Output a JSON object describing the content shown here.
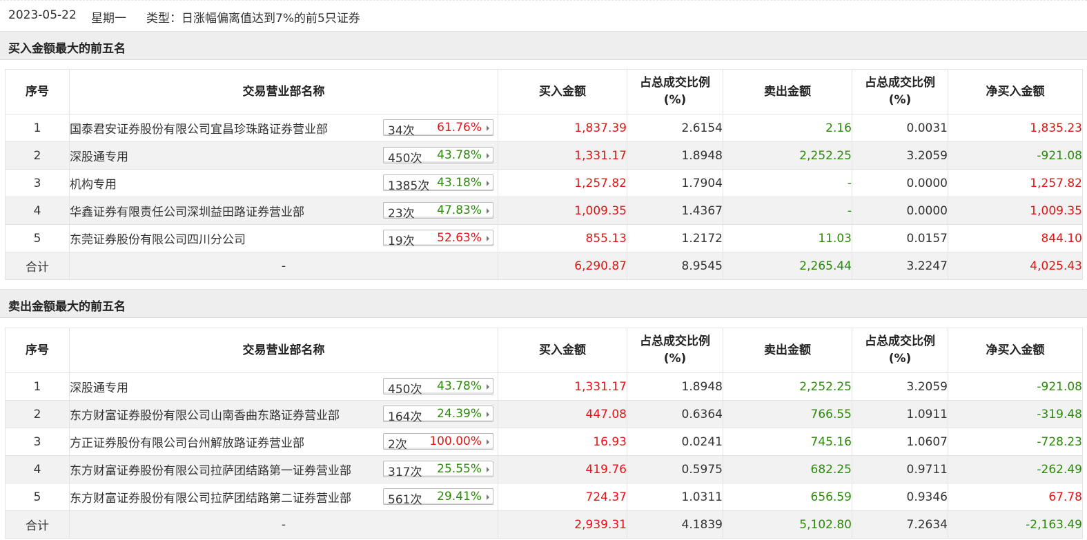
{
  "header": {
    "date": "2023-05-22",
    "weekday": "星期一",
    "type_text": "类型：日涨幅偏离值达到7%的前5只证券"
  },
  "columns": {
    "idx": "序号",
    "name": "交易营业部名称",
    "buy": "买入金额",
    "buy_ratio_line1": "占总成交比例",
    "buy_ratio_line2": "(%)",
    "sell": "卖出金额",
    "sell_ratio_line1": "占总成交比例",
    "sell_ratio_line2": "(%)",
    "net": "净买入金额"
  },
  "buy_section": {
    "title": "买入金额最大的前五名",
    "rows": [
      {
        "idx": "1",
        "name": "国泰君安证券股份有限公司宜昌珍珠路证券营业部",
        "count": "34次",
        "pct": "61.76%",
        "pct_color": "red",
        "buy": "1,837.39",
        "buy_ratio": "2.6154",
        "sell": "2.16",
        "sell_ratio": "0.0031",
        "net": "1,835.23",
        "net_color": "red"
      },
      {
        "idx": "2",
        "name": "深股通专用",
        "count": "450次",
        "pct": "43.78%",
        "pct_color": "green",
        "buy": "1,331.17",
        "buy_ratio": "1.8948",
        "sell": "2,252.25",
        "sell_ratio": "3.2059",
        "net": "-921.08",
        "net_color": "green"
      },
      {
        "idx": "3",
        "name": "机构专用",
        "count": "1385次",
        "pct": "43.18%",
        "pct_color": "green",
        "buy": "1,257.82",
        "buy_ratio": "1.7904",
        "sell": "-",
        "sell_ratio": "0.0000",
        "net": "1,257.82",
        "net_color": "red"
      },
      {
        "idx": "4",
        "name": "华鑫证券有限责任公司深圳益田路证券营业部",
        "count": "23次",
        "pct": "47.83%",
        "pct_color": "green",
        "buy": "1,009.35",
        "buy_ratio": "1.4367",
        "sell": "-",
        "sell_ratio": "0.0000",
        "net": "1,009.35",
        "net_color": "red"
      },
      {
        "idx": "5",
        "name": "东莞证券股份有限公司四川分公司",
        "count": "19次",
        "pct": "52.63%",
        "pct_color": "red",
        "buy": "855.13",
        "buy_ratio": "1.2172",
        "sell": "11.03",
        "sell_ratio": "0.0157",
        "net": "844.10",
        "net_color": "red"
      }
    ],
    "total": {
      "label": "合计",
      "name": "-",
      "buy": "6,290.87",
      "buy_ratio": "8.9545",
      "sell": "2,265.44",
      "sell_ratio": "3.2247",
      "net": "4,025.43",
      "net_color": "red"
    }
  },
  "sell_section": {
    "title": "卖出金额最大的前五名",
    "rows": [
      {
        "idx": "1",
        "name": "深股通专用",
        "count": "450次",
        "pct": "43.78%",
        "pct_color": "green",
        "buy": "1,331.17",
        "buy_ratio": "1.8948",
        "sell": "2,252.25",
        "sell_ratio": "3.2059",
        "net": "-921.08",
        "net_color": "green"
      },
      {
        "idx": "2",
        "name": "东方财富证券股份有限公司山南香曲东路证券营业部",
        "count": "164次",
        "pct": "24.39%",
        "pct_color": "green",
        "buy": "447.08",
        "buy_ratio": "0.6364",
        "sell": "766.55",
        "sell_ratio": "1.0911",
        "net": "-319.48",
        "net_color": "green"
      },
      {
        "idx": "3",
        "name": "方正证券股份有限公司台州解放路证券营业部",
        "count": "2次",
        "pct": "100.00%",
        "pct_color": "red",
        "buy": "16.93",
        "buy_ratio": "0.0241",
        "sell": "745.16",
        "sell_ratio": "1.0607",
        "net": "-728.23",
        "net_color": "green"
      },
      {
        "idx": "4",
        "name": "东方财富证券股份有限公司拉萨团结路第一证券营业部",
        "count": "317次",
        "pct": "25.55%",
        "pct_color": "green",
        "buy": "419.76",
        "buy_ratio": "0.5975",
        "sell": "682.25",
        "sell_ratio": "0.9711",
        "net": "-262.49",
        "net_color": "green"
      },
      {
        "idx": "5",
        "name": "东方财富证券股份有限公司拉萨团结路第二证券营业部",
        "count": "561次",
        "pct": "29.41%",
        "pct_color": "green",
        "buy": "724.37",
        "buy_ratio": "1.0311",
        "sell": "656.59",
        "sell_ratio": "0.9346",
        "net": "67.78",
        "net_color": "red"
      }
    ],
    "total": {
      "label": "合计",
      "name": "-",
      "buy": "2,939.31",
      "buy_ratio": "4.1839",
      "sell": "5,102.80",
      "sell_ratio": "7.2634",
      "net": "-2,163.49",
      "net_color": "green"
    }
  }
}
